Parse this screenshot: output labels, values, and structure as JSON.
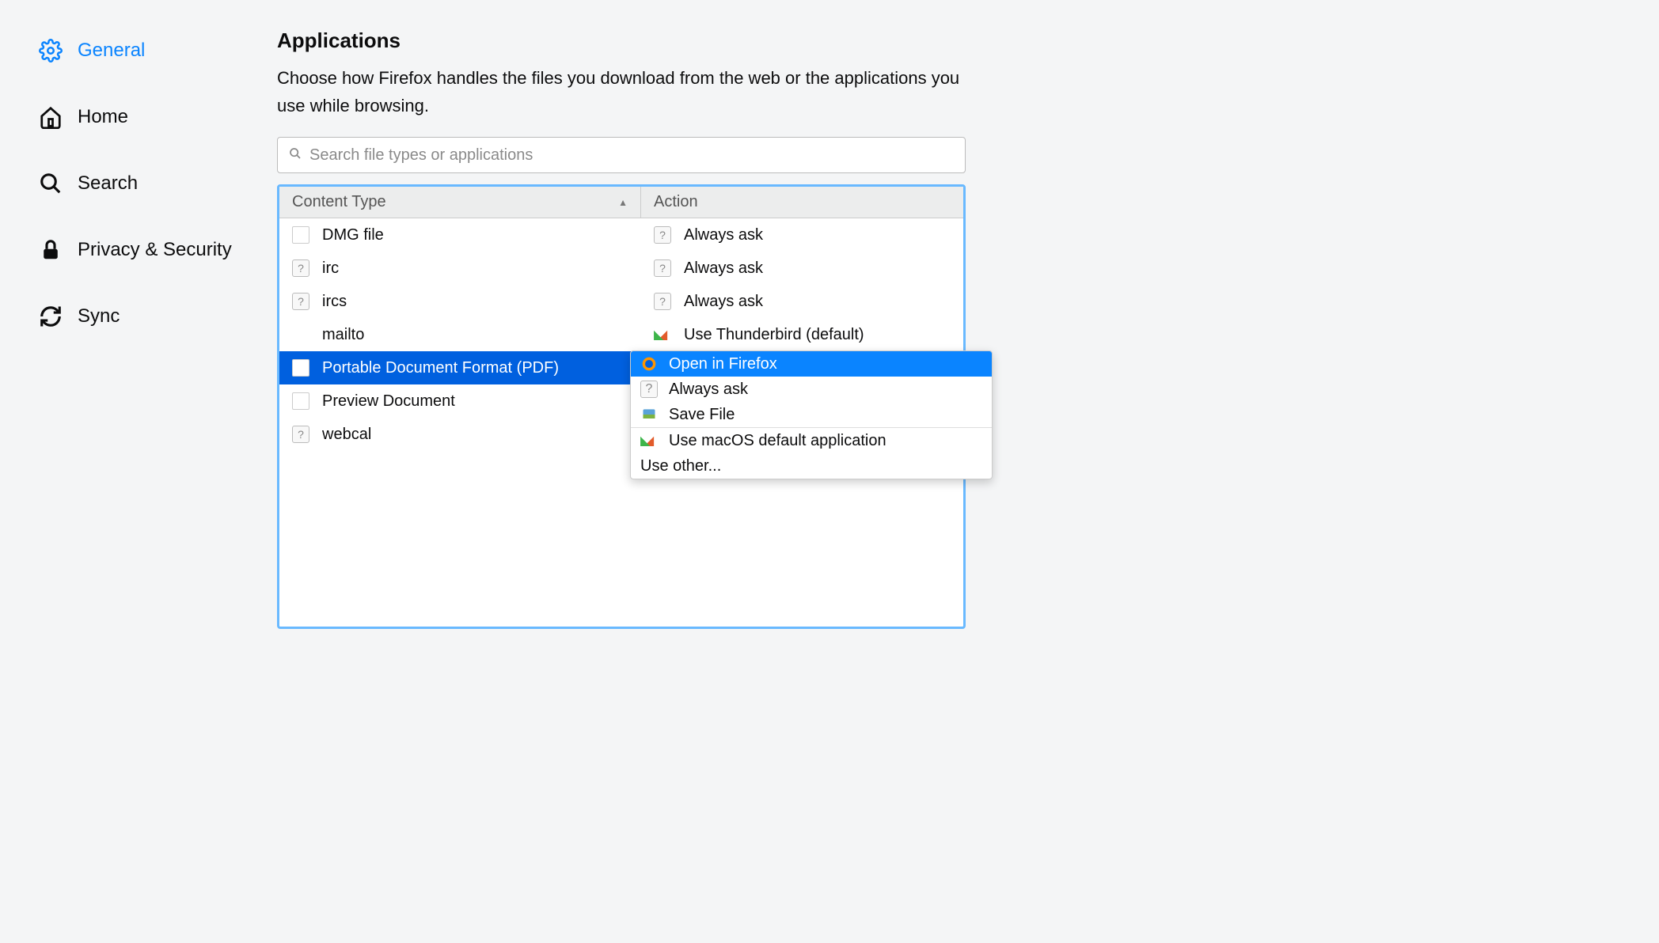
{
  "sidebar": {
    "items": [
      {
        "label": "General",
        "active": true,
        "icon": "gear"
      },
      {
        "label": "Home",
        "active": false,
        "icon": "home"
      },
      {
        "label": "Search",
        "active": false,
        "icon": "search"
      },
      {
        "label": "Privacy & Security",
        "active": false,
        "icon": "lock"
      },
      {
        "label": "Sync",
        "active": false,
        "icon": "sync"
      }
    ]
  },
  "main": {
    "title": "Applications",
    "description": "Choose how Firefox handles the files you download from the web or the applications you use while browsing.",
    "search_placeholder": "Search file types or applications",
    "columns": {
      "content_type": "Content Type",
      "action": "Action"
    },
    "rows": [
      {
        "type": "DMG file",
        "type_icon": "doc",
        "action": "Always ask",
        "action_icon": "ask",
        "selected": false
      },
      {
        "type": "irc",
        "type_icon": "q",
        "action": "Always ask",
        "action_icon": "ask",
        "selected": false
      },
      {
        "type": "ircs",
        "type_icon": "q",
        "action": "Always ask",
        "action_icon": "ask",
        "selected": false
      },
      {
        "type": "mailto",
        "type_icon": "",
        "action": "Use Thunderbird (default)",
        "action_icon": "launch",
        "selected": false
      },
      {
        "type": "Portable Document Format (PDF)",
        "type_icon": "doc-sel",
        "action": "Open in Firefox",
        "action_icon": "ffx",
        "selected": true
      },
      {
        "type": "Preview Document",
        "type_icon": "doc",
        "action": "",
        "action_icon": "",
        "selected": false
      },
      {
        "type": "webcal",
        "type_icon": "q",
        "action": "",
        "action_icon": "",
        "selected": false
      }
    ],
    "dropdown": {
      "items": [
        {
          "label": "Open in Firefox",
          "icon": "ffx",
          "highlighted": true
        },
        {
          "label": "Always ask",
          "icon": "ask",
          "highlighted": false
        },
        {
          "label": "Save File",
          "icon": "save",
          "highlighted": false
        },
        {
          "label": "Use macOS default application",
          "icon": "launch",
          "highlighted": false,
          "sep_before": true
        },
        {
          "label": "Use other...",
          "icon": "",
          "highlighted": false
        }
      ]
    }
  }
}
